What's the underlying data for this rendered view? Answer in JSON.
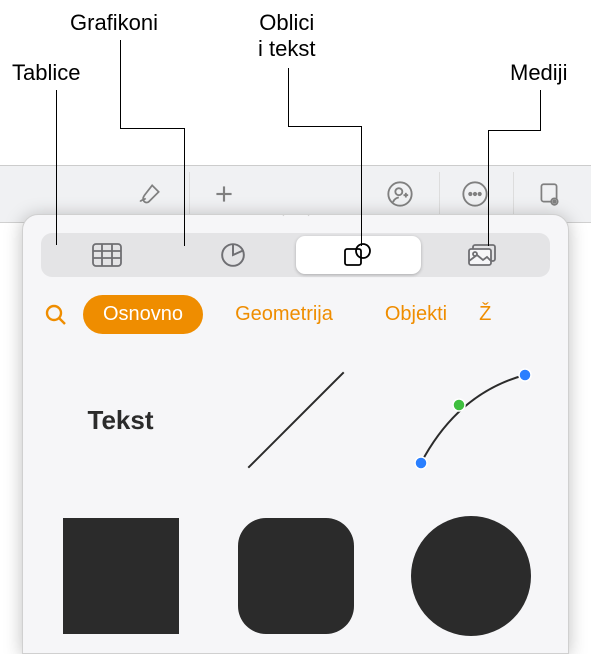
{
  "callouts": {
    "tables": "Tablice",
    "charts": "Grafikoni",
    "shapes_text_line1": "Oblici",
    "shapes_text_line2": "i tekst",
    "media": "Mediji"
  },
  "segment": {
    "tables_icon": "table-icon",
    "charts_icon": "piechart-icon",
    "shapes_icon": "shapes-icon",
    "media_icon": "media-icon",
    "active": "shapes"
  },
  "categories": {
    "active": "Osnovno",
    "items": [
      "Osnovno",
      "Geometrija",
      "Objekti"
    ],
    "overflow_letter": "Ž"
  },
  "shapes": {
    "text_label": "Tekst"
  },
  "colors": {
    "accent": "#ef8d00",
    "shape_fill": "#2b2b2b"
  }
}
